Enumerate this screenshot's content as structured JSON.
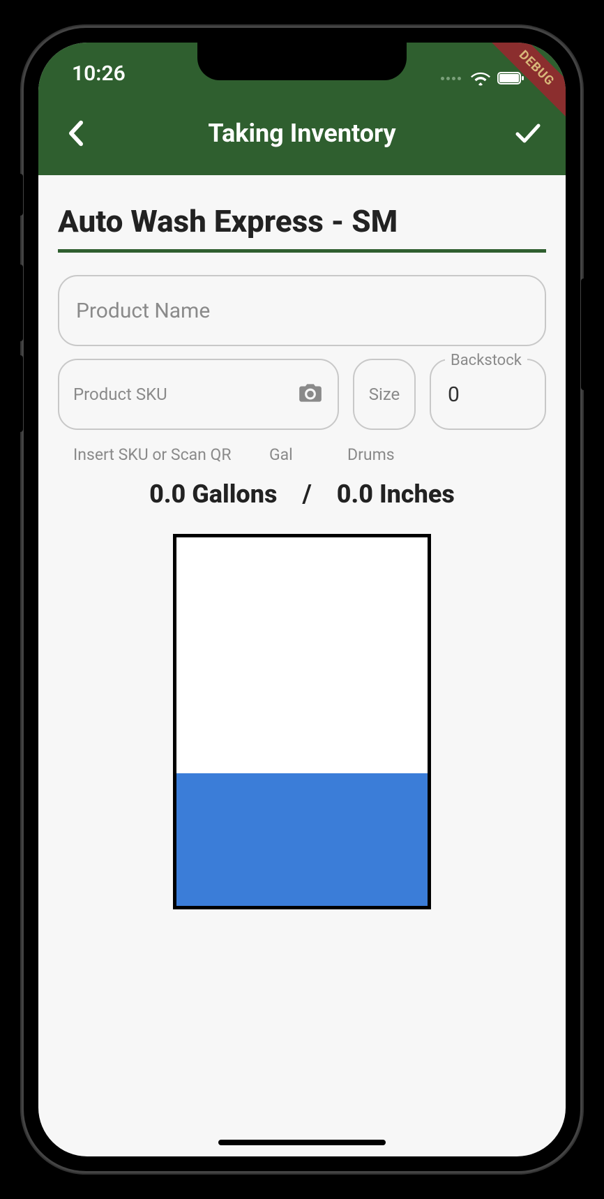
{
  "status": {
    "time": "10:26"
  },
  "debug_banner": "DEBUG",
  "appbar": {
    "title": "Taking Inventory"
  },
  "location": {
    "name": "Auto Wash Express - SM"
  },
  "product_name": {
    "placeholder": "Product Name",
    "value": ""
  },
  "product_sku": {
    "placeholder": "Product SKU",
    "value": "",
    "helper": "Insert SKU or Scan QR"
  },
  "size": {
    "placeholder": "Size",
    "value": "",
    "helper": "Gal"
  },
  "backstock": {
    "label": "Backstock",
    "value": "0",
    "helper": "Drums"
  },
  "readout": {
    "gallons": "0.0 Gallons",
    "separator": "/",
    "inches": "0.0 Inches"
  },
  "tank": {
    "fill_fraction": 0.36
  },
  "colors": {
    "brand_green": "#2f5f2f",
    "tank_fill": "#3b7dd8",
    "debug_banner": "#8b2e2e"
  }
}
